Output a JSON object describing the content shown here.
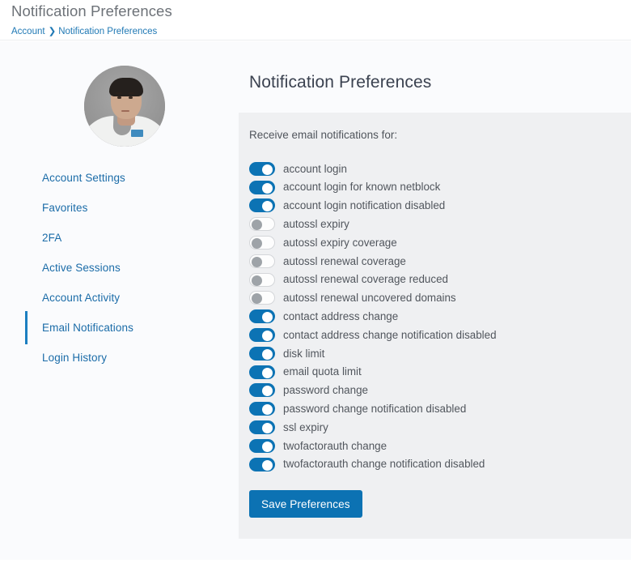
{
  "header": {
    "title": "Notification Preferences",
    "breadcrumb": {
      "root": "Account",
      "separator": "❯",
      "current": "Notification Preferences"
    }
  },
  "sidebar": {
    "avatar_alt": "user-avatar",
    "items": [
      {
        "label": "Account Settings",
        "active": false
      },
      {
        "label": "Favorites",
        "active": false
      },
      {
        "label": "2FA",
        "active": false
      },
      {
        "label": "Active Sessions",
        "active": false
      },
      {
        "label": "Account Activity",
        "active": false
      },
      {
        "label": "Email Notifications",
        "active": true
      },
      {
        "label": "Login History",
        "active": false
      }
    ]
  },
  "main": {
    "page_title": "Notification Preferences",
    "panel_lead": "Receive email notifications for:",
    "save_label": "Save Preferences",
    "toggles": [
      {
        "label": "account login",
        "on": true
      },
      {
        "label": "account login for known netblock",
        "on": true
      },
      {
        "label": "account login notification disabled",
        "on": true
      },
      {
        "label": "autossl expiry",
        "on": false
      },
      {
        "label": "autossl expiry coverage",
        "on": false
      },
      {
        "label": "autossl renewal coverage",
        "on": false
      },
      {
        "label": "autossl renewal coverage reduced",
        "on": false
      },
      {
        "label": "autossl renewal uncovered domains",
        "on": false
      },
      {
        "label": "contact address change",
        "on": true
      },
      {
        "label": "contact address change notification disabled",
        "on": true
      },
      {
        "label": "disk limit",
        "on": true
      },
      {
        "label": "email quota limit",
        "on": true
      },
      {
        "label": "password change",
        "on": true
      },
      {
        "label": "password change notification disabled",
        "on": true
      },
      {
        "label": "ssl expiry",
        "on": true
      },
      {
        "label": "twofactorauth change",
        "on": true
      },
      {
        "label": "twofactorauth change notification disabled",
        "on": true
      }
    ]
  },
  "colors": {
    "accent_blue": "#0c73b4",
    "link_blue": "#1b6ca8",
    "panel_bg": "#eff0f2",
    "content_bg": "#fafbfd",
    "toggle_off_knob": "#9ea3a8"
  }
}
